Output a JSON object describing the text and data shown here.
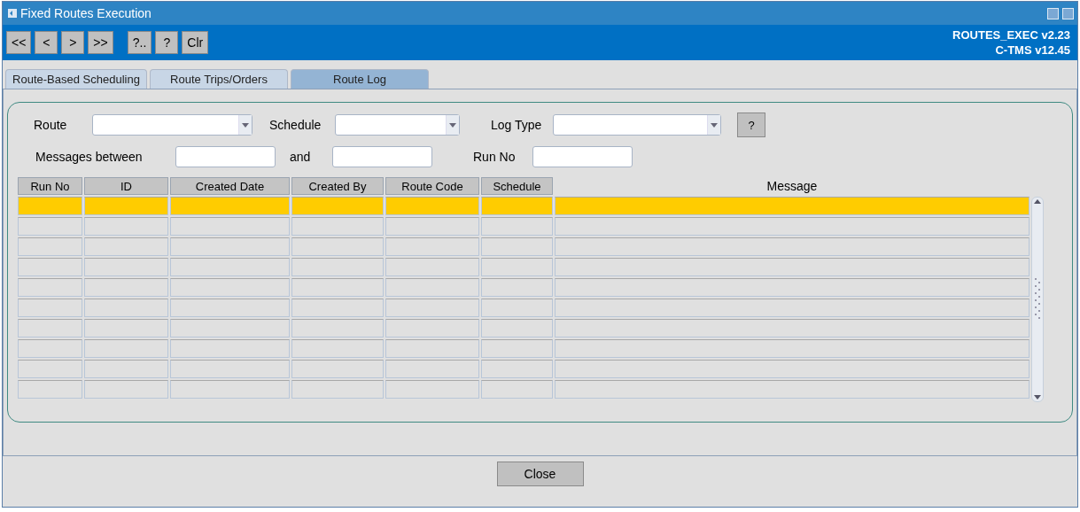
{
  "window": {
    "title": "Fixed Routes Execution"
  },
  "toolbar": {
    "buttons": [
      "<<",
      "<",
      ">",
      ">>",
      "?..",
      "?",
      "Clr"
    ],
    "version_lines": [
      "ROUTES_EXEC v2.23",
      "C-TMS v12.45"
    ]
  },
  "tabs": [
    {
      "label": "Route-Based Scheduling",
      "selected": false
    },
    {
      "label": "Route Trips/Orders",
      "selected": false
    },
    {
      "label": "Route Log",
      "selected": true
    }
  ],
  "filters": {
    "route_label": "Route",
    "schedule_label": "Schedule",
    "log_type_label": "Log Type",
    "help_button": "?",
    "messages_between_label": "Messages between",
    "and_label": "and",
    "run_no_label": "Run No"
  },
  "table": {
    "columns": [
      "Run No",
      "ID",
      "Created Date",
      "Created By",
      "Route Code",
      "Schedule",
      "Message"
    ],
    "rows": [
      {
        "selected": true
      },
      {
        "selected": false
      },
      {
        "selected": false
      },
      {
        "selected": false
      },
      {
        "selected": false
      },
      {
        "selected": false
      },
      {
        "selected": false
      },
      {
        "selected": false
      },
      {
        "selected": false
      },
      {
        "selected": false
      }
    ]
  },
  "footer": {
    "close_button": "Close"
  }
}
